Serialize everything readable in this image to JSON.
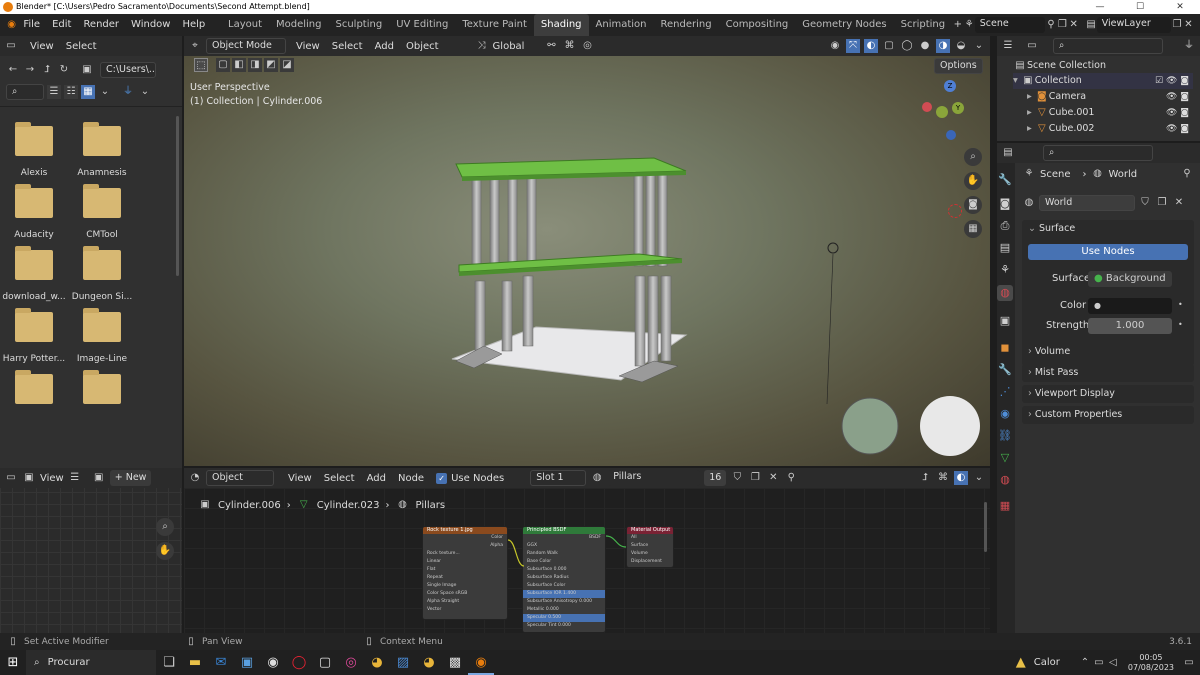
{
  "window": {
    "title": "Blender* [C:\\Users\\Pedro Sacramento\\Documents\\Second Attempt.blend]"
  },
  "menu": [
    "File",
    "Edit",
    "Render",
    "Window",
    "Help"
  ],
  "workspaces": [
    "Layout",
    "Modeling",
    "Sculpting",
    "UV Editing",
    "Texture Paint",
    "Shading",
    "Animation",
    "Rendering",
    "Compositing",
    "Geometry Nodes",
    "Scripting"
  ],
  "active_workspace": "Shading",
  "scene": "Scene",
  "view_layer": "ViewLayer",
  "file_browser": {
    "header": [
      "View",
      "Select"
    ],
    "path": "C:\\Users\\...",
    "folders": [
      "Alexis",
      "Anamnesis",
      "Audacity",
      "CMTool",
      "download_w...",
      "Dungeon Si...",
      "Harry Potter...",
      "Image-Line",
      "",
      ""
    ]
  },
  "viewport": {
    "mode": "Object Mode",
    "menus": [
      "View",
      "Select",
      "Add",
      "Object"
    ],
    "orientation": "Global",
    "options": "Options",
    "overlay_line1": "User Perspective",
    "overlay_line2": "(1) Collection | Cylinder.006",
    "gizmo": {
      "x": "X",
      "y": "Y",
      "z": "Z"
    }
  },
  "outliner": {
    "root": "Scene Collection",
    "collection": "Collection",
    "items": [
      "Camera",
      "Cube.001",
      "Cube.002"
    ]
  },
  "properties": {
    "scene": "Scene",
    "world": "World",
    "world_name": "World",
    "surface_panel": "Surface",
    "use_nodes": "Use Nodes",
    "surface_label": "Surface",
    "surface_value": "Background",
    "color_label": "Color",
    "strength_label": "Strength",
    "strength_value": "1.000",
    "panels": [
      "Volume",
      "Mist Pass",
      "Viewport Display",
      "Custom Properties"
    ]
  },
  "image_editor": {
    "view": "View",
    "new": "New"
  },
  "node_editor": {
    "type": "Object",
    "menus": [
      "View",
      "Select",
      "Add",
      "Node"
    ],
    "use_nodes": "Use Nodes",
    "slot": "Slot 1",
    "material": "Pillars",
    "users": "16",
    "breadcrumb": [
      "Cylinder.006",
      "Cylinder.023",
      "Pillars"
    ],
    "nodes": {
      "tex": {
        "title": "Rock texture 1.jpg",
        "rows": [
          "Color",
          "Alpha",
          "Rock texture...",
          "Linear",
          "Flat",
          "Repeat",
          "Single Image",
          "Color Space  sRGB",
          "Alpha  Straight",
          "Vector"
        ]
      },
      "bsdf": {
        "title": "Principled BSDF",
        "rows": [
          "BSDF",
          "GGX",
          "Random Walk",
          "Base Color",
          "Subsurface  0.000",
          "Subsurface Radius",
          "Subsurface Color",
          "Subsurface IOR  1.400",
          "Subsurface Anisotropy  0.000",
          "Metallic  0.000",
          "Specular  0.500",
          "Specular Tint  0.000"
        ]
      },
      "out": {
        "title": "Material Output",
        "rows": [
          "All",
          "Surface",
          "Volume",
          "Displacement"
        ]
      }
    }
  },
  "status": {
    "left": "Set Active Modifier",
    "mid": "Pan View",
    "right": "Context Menu",
    "version": "3.6.1"
  },
  "taskbar": {
    "search": "Procurar",
    "weather": "Calor",
    "time": "00:05",
    "date": "07/08/2023"
  },
  "colors": {
    "accent": "#4772b3",
    "green_slab": "#6fbf45",
    "header": "#2b2b2b"
  }
}
